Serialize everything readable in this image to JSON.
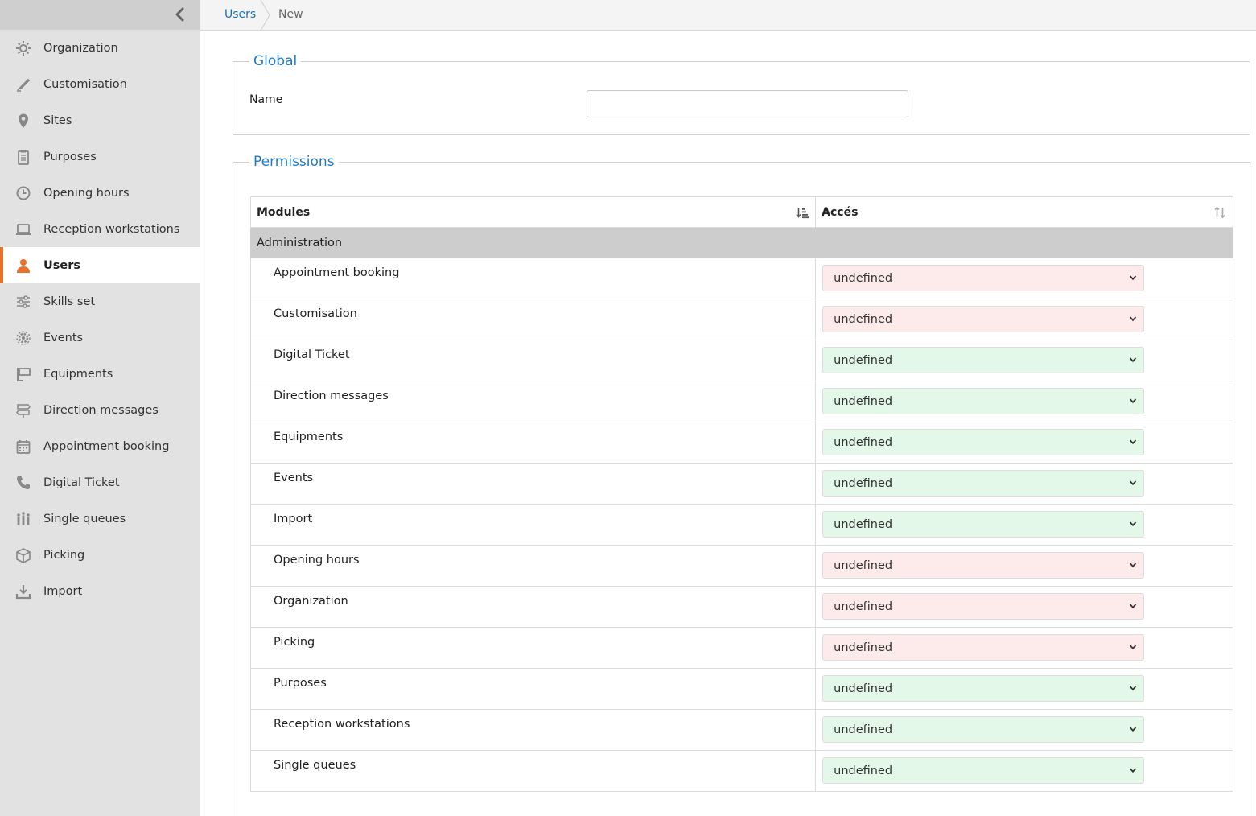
{
  "sidebar": {
    "items": [
      {
        "label": "Organization",
        "icon": "cog-cluster-icon",
        "active": false
      },
      {
        "label": "Customisation",
        "icon": "brush-icon",
        "active": false
      },
      {
        "label": "Sites",
        "icon": "map-pin-icon",
        "active": false
      },
      {
        "label": "Purposes",
        "icon": "clipboard-icon",
        "active": false
      },
      {
        "label": "Opening hours",
        "icon": "clock-icon",
        "active": false
      },
      {
        "label": "Reception workstations",
        "icon": "laptop-icon",
        "active": false
      },
      {
        "label": "Users",
        "icon": "user-icon",
        "active": true
      },
      {
        "label": "Skills set",
        "icon": "sliders-icon",
        "active": false
      },
      {
        "label": "Events",
        "icon": "gears-icon",
        "active": false
      },
      {
        "label": "Equipments",
        "icon": "screen-stand-icon",
        "active": false
      },
      {
        "label": "Direction messages",
        "icon": "signpost-icon",
        "active": false
      },
      {
        "label": "Appointment booking",
        "icon": "calendar-icon",
        "active": false
      },
      {
        "label": "Digital Ticket",
        "icon": "phone-icon",
        "active": false
      },
      {
        "label": "Single queues",
        "icon": "queue-icon",
        "active": false
      },
      {
        "label": "Picking",
        "icon": "box-icon",
        "active": false
      },
      {
        "label": "Import",
        "icon": "download-icon",
        "active": false
      }
    ]
  },
  "breadcrumb": {
    "parent": "Users",
    "current": "New"
  },
  "global": {
    "legend": "Global",
    "name_label": "Name",
    "name_value": "",
    "name_placeholder": ""
  },
  "permissions": {
    "legend": "Permissions",
    "col_modules": "Modules",
    "col_access": "Accés",
    "group": "Administration",
    "rows": [
      {
        "module": "Appointment booking",
        "access": "undefined",
        "state": "red"
      },
      {
        "module": "Customisation",
        "access": "undefined",
        "state": "red"
      },
      {
        "module": "Digital Ticket",
        "access": "undefined",
        "state": "green"
      },
      {
        "module": "Direction messages",
        "access": "undefined",
        "state": "green"
      },
      {
        "module": "Equipments",
        "access": "undefined",
        "state": "green"
      },
      {
        "module": "Events",
        "access": "undefined",
        "state": "green"
      },
      {
        "module": "Import",
        "access": "undefined",
        "state": "green"
      },
      {
        "module": "Opening hours",
        "access": "undefined",
        "state": "red"
      },
      {
        "module": "Organization",
        "access": "undefined",
        "state": "red"
      },
      {
        "module": "Picking",
        "access": "undefined",
        "state": "red"
      },
      {
        "module": "Purposes",
        "access": "undefined",
        "state": "green"
      },
      {
        "module": "Reception workstations",
        "access": "undefined",
        "state": "green"
      },
      {
        "module": "Single queues",
        "access": "undefined",
        "state": "green"
      }
    ]
  },
  "colors": {
    "accent": "#e8702a",
    "link": "#1e6fb5",
    "legend": "#1e7bc4",
    "deny_bg": "#fdeaea",
    "allow_bg": "#e4f8e9"
  }
}
